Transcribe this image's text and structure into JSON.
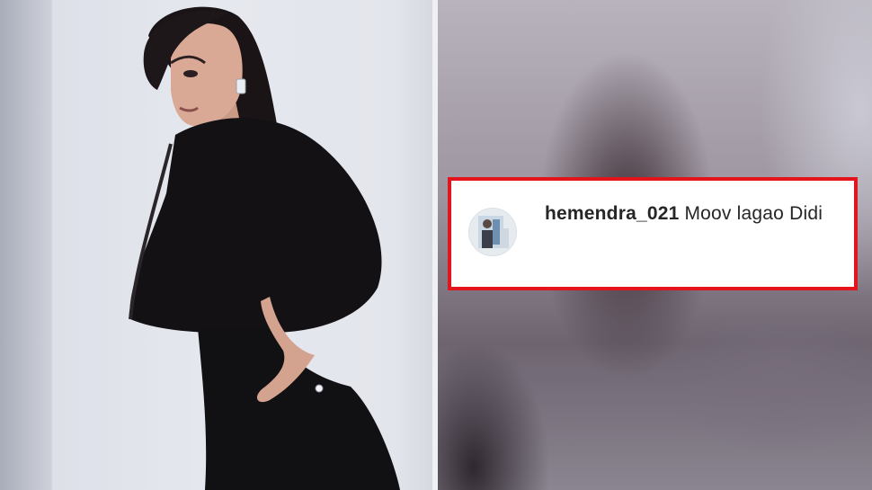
{
  "photo": {
    "icon": "woman-portrait-photo"
  },
  "comment": {
    "username": "hemendra_021",
    "text": "Moov lagao Didi",
    "avatar_icon": "user-avatar-icon",
    "highlight_color": "#e3141b"
  }
}
